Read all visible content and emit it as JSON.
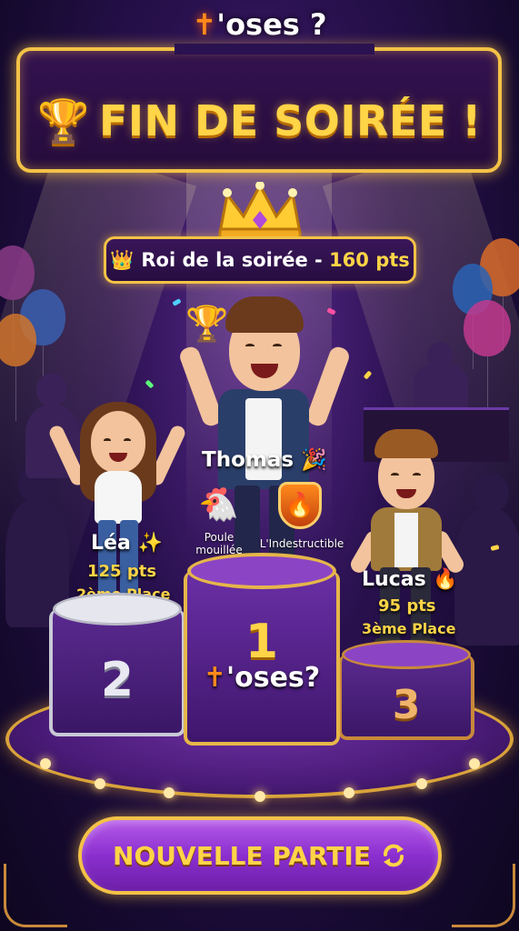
{
  "header": {
    "brand_cross": "✝",
    "brand_text": "'oses ?",
    "title": "FIN DE SOIRÉE !",
    "title_icon": "trophy-icon"
  },
  "king": {
    "banner_text": "Roi de la soirée - ",
    "points": "160 pts",
    "icon": "crown-icon"
  },
  "players": {
    "first": {
      "name": "Thomas",
      "emoji": "🎉"
    },
    "second": {
      "name": "Léa",
      "emoji": "✨",
      "points": "125 pts",
      "place": "2ème Place"
    },
    "third": {
      "name": "Lucas",
      "emoji": "🔥",
      "points": "95 pts",
      "place": "3ème Place"
    }
  },
  "badges": {
    "poule": {
      "line1": "Poule",
      "line2": "mouillée",
      "icon": "chicken-icon"
    },
    "indestructible": {
      "label": "L'Indestructible",
      "icon": "fire-shield-icon"
    }
  },
  "podium": {
    "second_number": "2",
    "first_number": "1",
    "third_number": "3",
    "first_brand_cross": "✝",
    "first_brand_text": "'oses?"
  },
  "actions": {
    "new_game": "NOUVELLE PARTIE",
    "new_game_icon": "refresh-icon"
  },
  "colors": {
    "gold": "#ffd447",
    "frame": "#f3c247",
    "purple_button": "#8b2fcf",
    "background": "#2a1150"
  }
}
